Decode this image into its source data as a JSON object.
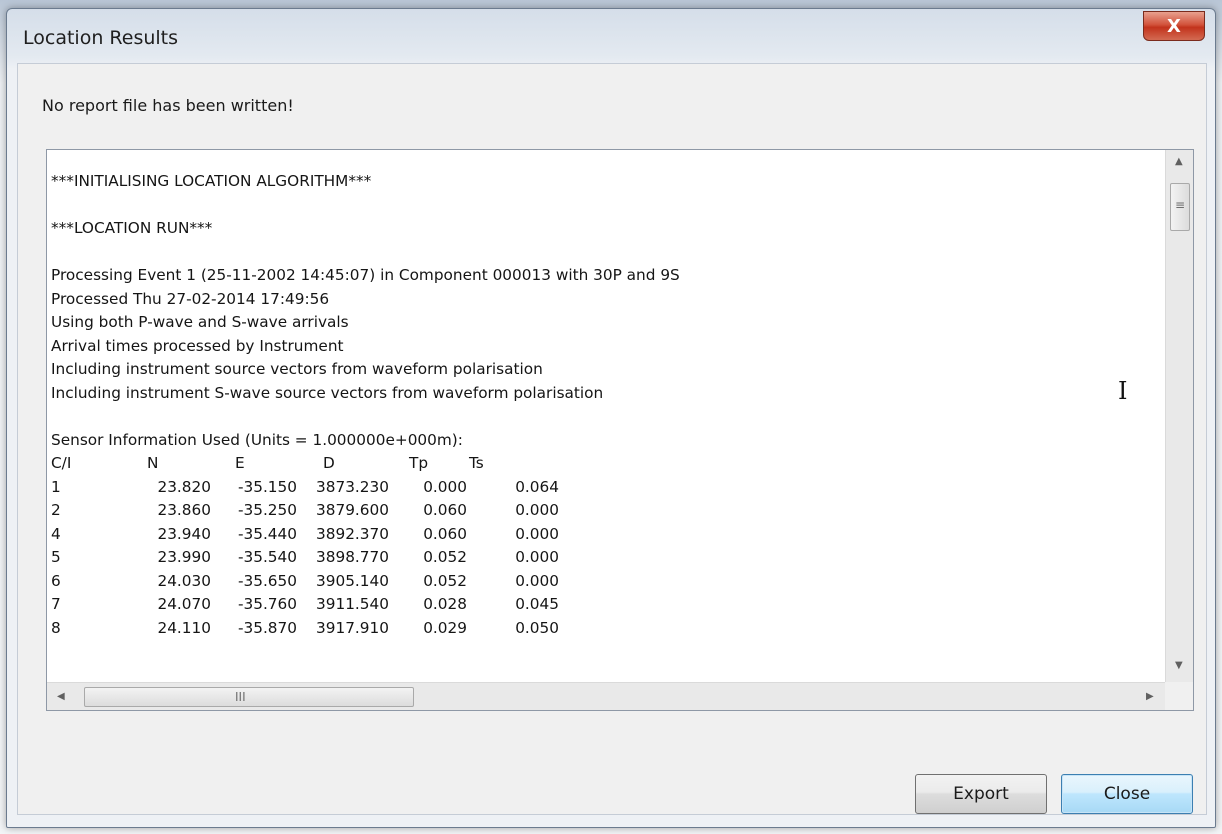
{
  "window": {
    "title": "Location Results",
    "close_glyph": "X"
  },
  "status_message": "No report file has been written!",
  "log": {
    "lines_top": [
      "***INITIALISING LOCATION ALGORITHM***",
      "",
      "***LOCATION RUN***",
      "",
      "Processing Event 1 (25-11-2002 14:45:07) in Component 000013 with 30P and 9S",
      "Processed Thu 27-02-2014 17:49:56",
      "Using both P-wave and S-wave arrivals",
      "Arrival times processed by Instrument",
      "Including instrument source vectors from waveform polarisation",
      "Including instrument S-wave source vectors from waveform polarisation",
      "",
      "Sensor Information Used (Units = 1.000000e+000m):"
    ],
    "table_headers": [
      "C/I",
      "N",
      "E",
      "D",
      "Tp",
      "Ts"
    ],
    "table_rows": [
      [
        "1",
        "23.820",
        "-35.150",
        "3873.230",
        "0.000",
        "0.064"
      ],
      [
        "2",
        "23.860",
        "-35.250",
        "3879.600",
        "0.060",
        "0.000"
      ],
      [
        "4",
        "23.940",
        "-35.440",
        "3892.370",
        "0.060",
        "0.000"
      ],
      [
        "5",
        "23.990",
        "-35.540",
        "3898.770",
        "0.052",
        "0.000"
      ],
      [
        "6",
        "24.030",
        "-35.650",
        "3905.140",
        "0.052",
        "0.000"
      ],
      [
        "7",
        "24.070",
        "-35.760",
        "3911.540",
        "0.028",
        "0.045"
      ],
      [
        "8",
        "24.110",
        "-35.870",
        "3917.910",
        "0.029",
        "0.050"
      ]
    ]
  },
  "scrollbars": {
    "up_arrow": "▲",
    "down_arrow": "▼",
    "left_arrow": "◀",
    "right_arrow": "▶",
    "grip_v": "≡",
    "grip_h": "III"
  },
  "buttons": {
    "export": "Export",
    "close": "Close"
  },
  "colors": {
    "title_close_bg": "#c2331c",
    "default_button_border": "#3c7fb1"
  }
}
